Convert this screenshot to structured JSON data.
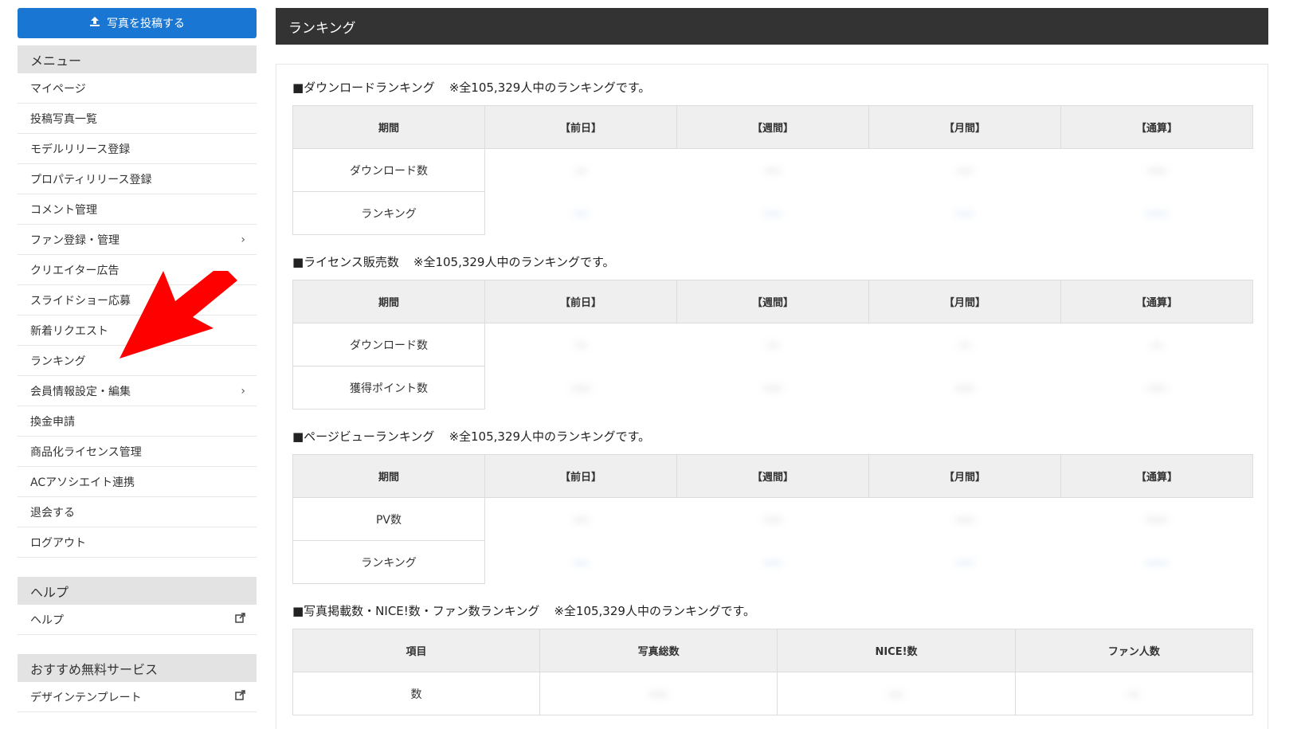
{
  "sidebar": {
    "upload_button": "写真を投稿する",
    "menu_header": "メニュー",
    "menu_items": [
      {
        "label": "マイページ",
        "chevron": false
      },
      {
        "label": "投稿写真一覧",
        "chevron": false
      },
      {
        "label": "モデルリリース登録",
        "chevron": false
      },
      {
        "label": "プロパティリリース登録",
        "chevron": false
      },
      {
        "label": "コメント管理",
        "chevron": false
      },
      {
        "label": "ファン登録・管理",
        "chevron": true
      },
      {
        "label": "クリエイター広告",
        "chevron": false
      },
      {
        "label": "スライドショー応募",
        "chevron": false
      },
      {
        "label": "新着リクエスト",
        "chevron": false
      },
      {
        "label": "ランキング",
        "chevron": false
      },
      {
        "label": "会員情報設定・編集",
        "chevron": true
      },
      {
        "label": "換金申請",
        "chevron": false
      },
      {
        "label": "商品化ライセンス管理",
        "chevron": false
      },
      {
        "label": "ACアソシエイト連携",
        "chevron": false
      },
      {
        "label": "退会する",
        "chevron": false
      },
      {
        "label": "ログアウト",
        "chevron": false
      }
    ],
    "help_header": "ヘルプ",
    "help_items": [
      {
        "label": "ヘルプ"
      }
    ],
    "osusume_header": "おすすめ無料サービス",
    "osusume_items": [
      {
        "label": "デザインテンプレート"
      }
    ]
  },
  "main": {
    "title": "ランキング",
    "sections": [
      {
        "title": "■ダウンロードランキング",
        "note": "※全105,329人中のランキングです。",
        "headers": [
          "期間",
          "【前日】",
          "【週間】",
          "【月間】",
          "【通算】"
        ],
        "rows": [
          {
            "label": "ダウンロード数",
            "values": [
              "---",
              "----",
              "----",
              "-----"
            ],
            "link": false
          },
          {
            "label": "ランキング",
            "values": [
              "----",
              "-----",
              "-----",
              "------"
            ],
            "link": true
          }
        ]
      },
      {
        "title": "■ライセンス販売数",
        "note": "※全105,329人中のランキングです。",
        "headers": [
          "期間",
          "【前日】",
          "【週間】",
          "【月間】",
          "【通算】"
        ],
        "rows": [
          {
            "label": "ダウンロード数",
            "values": [
              "---",
              "---",
              "---",
              "---"
            ],
            "link": false
          },
          {
            "label": "獲得ポイント数",
            "values": [
              "-----",
              "-----",
              "-----",
              "-----"
            ],
            "link": false
          }
        ]
      },
      {
        "title": "■ページビューランキング",
        "note": "※全105,329人中のランキングです。",
        "headers": [
          "期間",
          "【前日】",
          "【週間】",
          "【月間】",
          "【通算】"
        ],
        "rows": [
          {
            "label": "PV数",
            "values": [
              "----",
              "-----",
              "-----",
              "------"
            ],
            "link": false
          },
          {
            "label": "ランキング",
            "values": [
              "----",
              "-----",
              "-----",
              "------"
            ],
            "link": true
          }
        ]
      },
      {
        "title": "■写真掲載数・NICE!数・ファン数ランキング",
        "note": "※全105,329人中のランキングです。",
        "headers": [
          "項目",
          "写真総数",
          "NICE!数",
          "ファン人数"
        ],
        "rows": [
          {
            "label": "数",
            "values": [
              "-----",
              "----",
              "---"
            ],
            "link": false
          }
        ]
      }
    ]
  },
  "colors": {
    "upload_button": "#1976d2",
    "title_bar": "#333333",
    "arrow": "#ff0000"
  }
}
